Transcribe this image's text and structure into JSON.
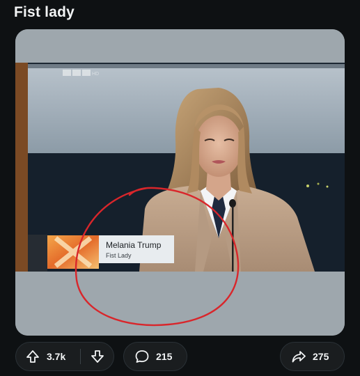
{
  "post": {
    "title": "Fist lady"
  },
  "media": {
    "watermark": "RTL HD",
    "lower_third_name": "Melania Trump",
    "lower_third_caption": "Fist Lady"
  },
  "actions": {
    "upvotes": "3.7k",
    "comments": "215",
    "shares": "275"
  },
  "icons": {
    "upvote": "arrow-up-icon",
    "downvote": "arrow-down-icon",
    "comment": "speech-bubble-icon",
    "share": "share-arrow-icon"
  },
  "colors": {
    "background": "#0e1113",
    "pill_background": "#1a1d1f",
    "circle_annotation": "#d9262b",
    "lower_third_bg": "#e8ecef"
  }
}
